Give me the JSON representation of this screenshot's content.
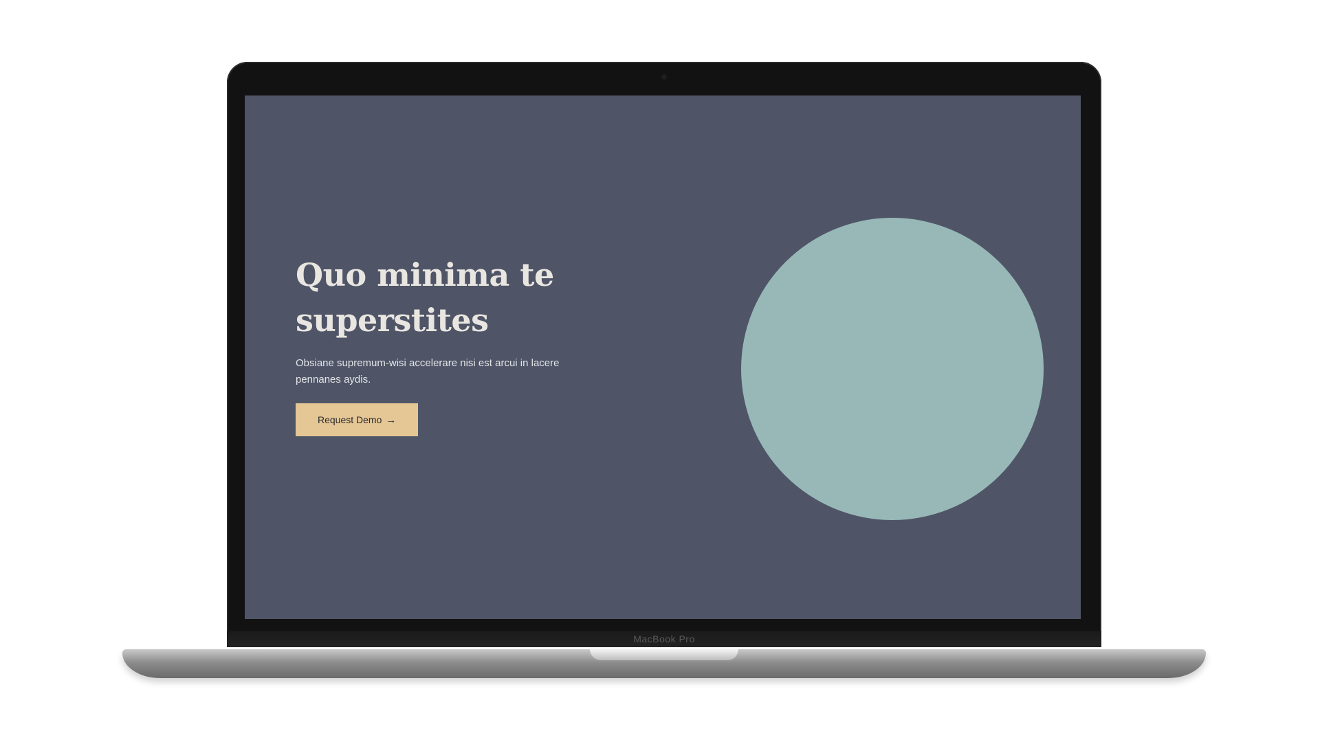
{
  "device": {
    "model_label": "MacBook Pro"
  },
  "hero": {
    "title": "Quo minima te superstites",
    "subtitle": "Obsiane supremum-wisi accelerare nisi est arcui in lacere pennanes aydis.",
    "cta_label": "Request Demo",
    "cta_icon": "arrow-right-icon"
  },
  "colors": {
    "screen_background": "#4f5567",
    "circle": "#98b8b8",
    "cta_background": "#e5c695",
    "title_text": "#e9e6e1"
  }
}
